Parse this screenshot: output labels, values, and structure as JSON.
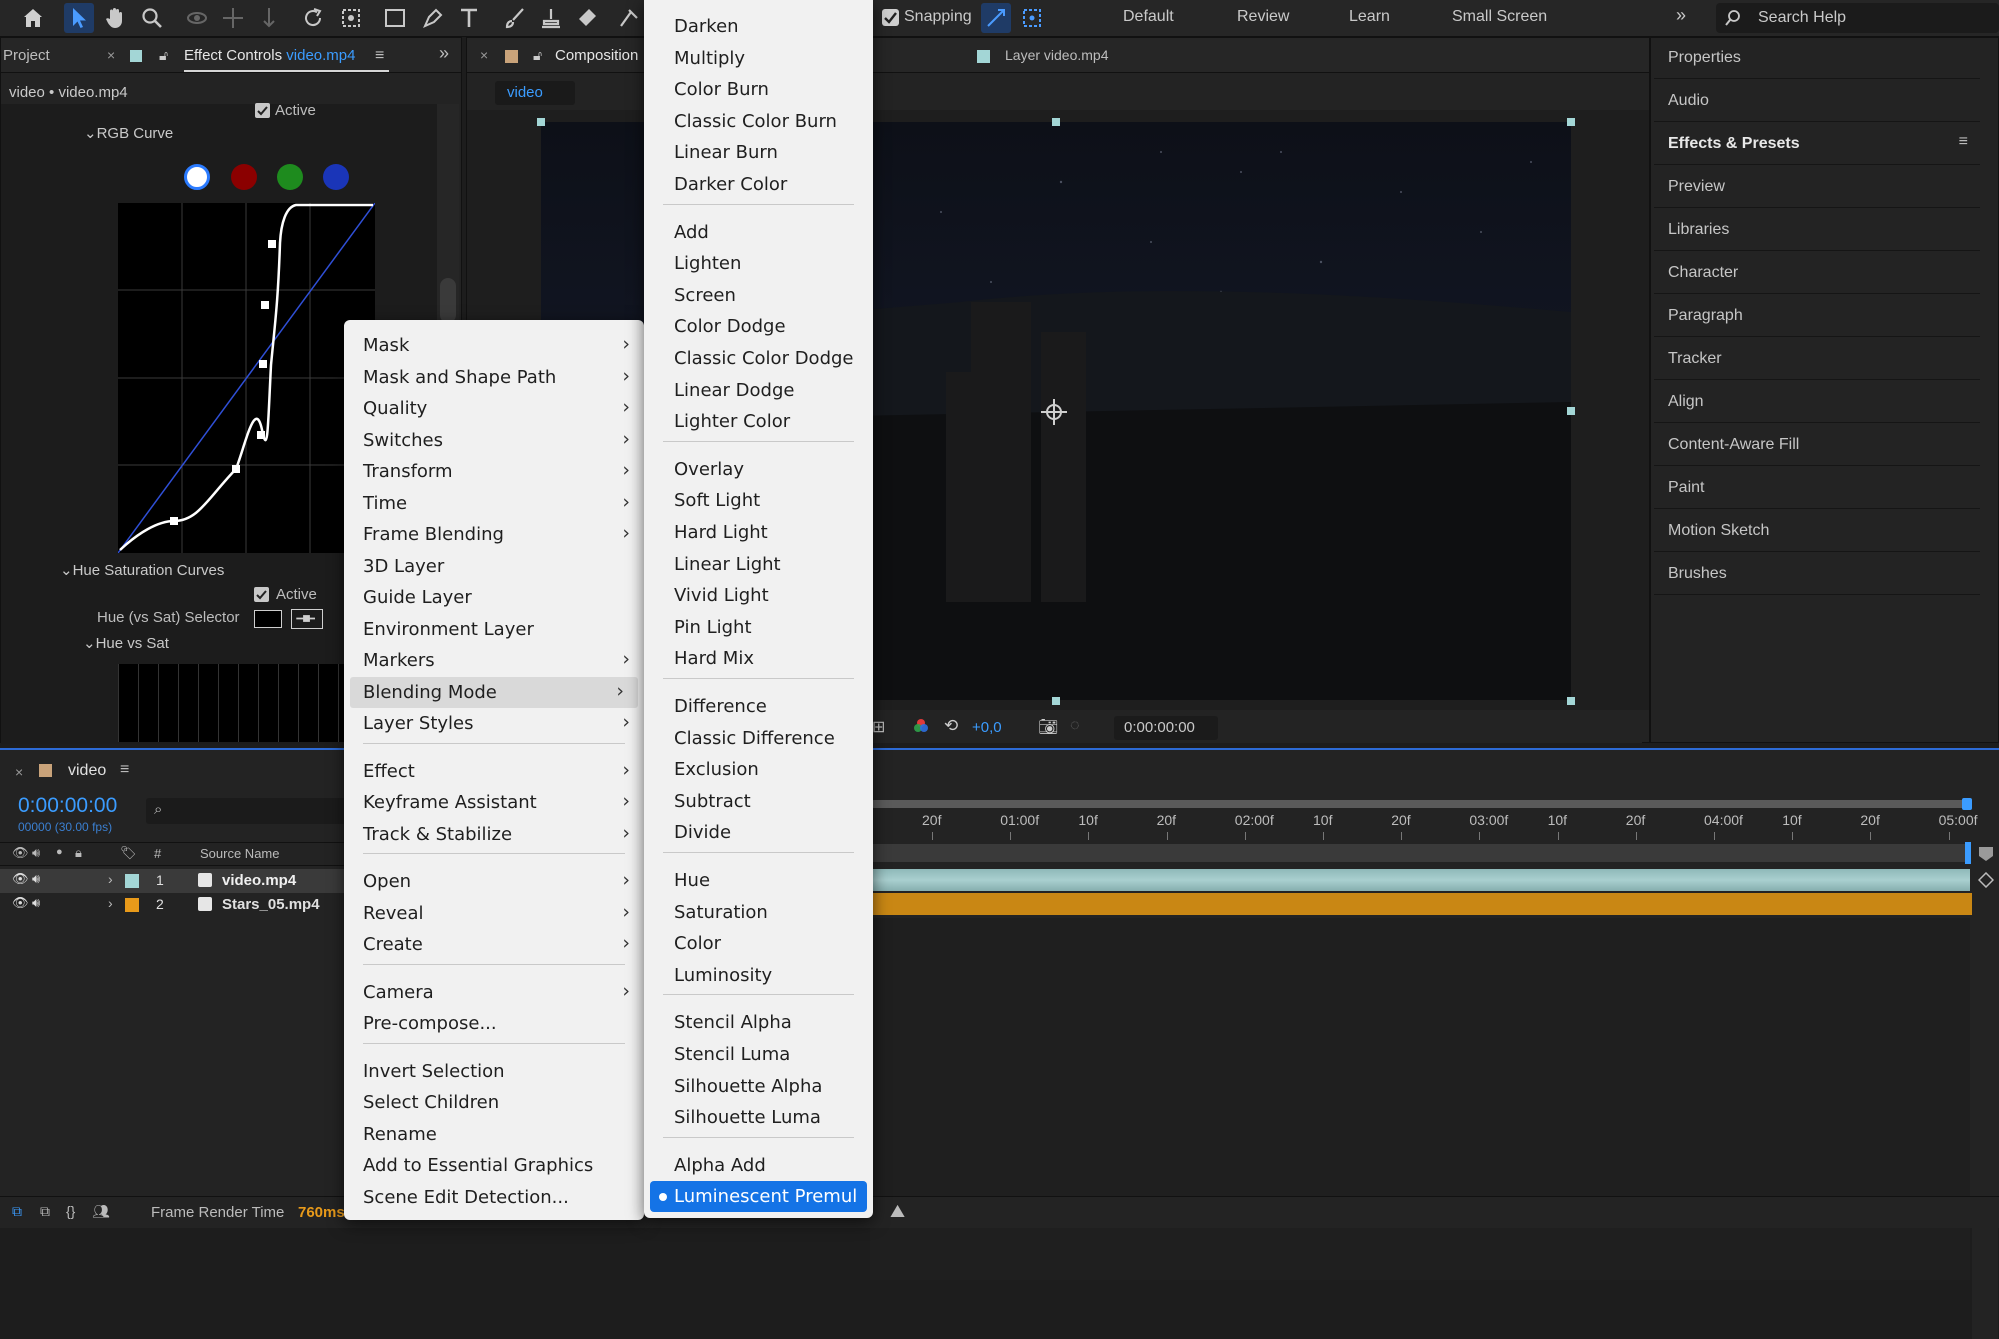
{
  "toolbar": {
    "snapping_label": "Snapping",
    "workspaces": [
      "Default",
      "Review",
      "Learn",
      "Small Screen"
    ],
    "search_placeholder": "Search Help",
    "icons": [
      "home-icon",
      "selection-arrow-icon",
      "hand-icon",
      "zoom-icon",
      "orbit-icon",
      "pan-icon",
      "dolly-icon",
      "rotate-icon",
      "camera-track-icon",
      "rectangle-icon",
      "pen-icon",
      "type-icon",
      "brush-icon",
      "clone-stamp-icon",
      "eraser-icon",
      "roto-brush-icon"
    ]
  },
  "project_tab": {
    "label": "Project"
  },
  "effect_controls": {
    "tab_label": "Effect Controls",
    "tab_file": "video.mp4",
    "breadcrumb": "video • video.mp4",
    "active_label_1": "Active",
    "rgb_curve_label": "RGB Curve",
    "hue_sat_curves_label": "Hue Saturation Curves",
    "active_label_2": "Active",
    "hue_vs_sat_selector_label": "Hue (vs Sat) Selector",
    "hue_vs_sat_label": "Hue vs Sat",
    "channel_colors": [
      "#ffffff",
      "#8b0000",
      "#1e8b1e",
      "#1a35b8"
    ]
  },
  "composition": {
    "tab_label": "Composition",
    "comp_tab": "video",
    "layer_tab": "Layer video.mp4",
    "exposure_value": "+0,0",
    "timecode": "0:00:00:00"
  },
  "right_panel": {
    "items": [
      "Properties",
      "Audio",
      "Effects & Presets",
      "Preview",
      "Libraries",
      "Character",
      "Paragraph",
      "Tracker",
      "Align",
      "Content-Aware Fill",
      "Paint",
      "Motion Sketch",
      "Brushes"
    ]
  },
  "timeline": {
    "comp_name": "video",
    "timecode": "0:00:00:00",
    "frames_fps": "00000 (30.00 fps)",
    "source_name_header": "Source Name",
    "number_header": "#",
    "layers": [
      {
        "num": "1",
        "name": "video.mp4",
        "color": "#a3d6d6"
      },
      {
        "num": "2",
        "name": "Stars_05.mp4",
        "color": "#e89a1a"
      }
    ],
    "ruler_labels": [
      "20f",
      "01:00f",
      "10f",
      "20f",
      "02:00f",
      "10f",
      "20f",
      "03:00f",
      "10f",
      "20f",
      "04:00f",
      "10f",
      "20f",
      "05:00f"
    ],
    "frame_render_label": "Frame Render Time",
    "frame_render_value": "760ms"
  },
  "context_menu": {
    "items": [
      {
        "label": "Mask",
        "sub": true
      },
      {
        "label": "Mask and Shape Path",
        "sub": true
      },
      {
        "label": "Quality",
        "sub": true
      },
      {
        "label": "Switches",
        "sub": true
      },
      {
        "label": "Transform",
        "sub": true
      },
      {
        "label": "Time",
        "sub": true
      },
      {
        "label": "Frame Blending",
        "sub": true
      },
      {
        "label": "3D Layer",
        "sub": false
      },
      {
        "label": "Guide Layer",
        "sub": false
      },
      {
        "label": "Environment Layer",
        "sub": false
      },
      {
        "label": "Markers",
        "sub": true
      },
      {
        "label": "Blending Mode",
        "sub": true
      },
      {
        "label": "Layer Styles",
        "sub": true
      },
      {
        "label": "Effect",
        "sub": true
      },
      {
        "label": "Keyframe Assistant",
        "sub": true
      },
      {
        "label": "Track & Stabilize",
        "sub": true
      },
      {
        "label": "Open",
        "sub": true
      },
      {
        "label": "Reveal",
        "sub": true
      },
      {
        "label": "Create",
        "sub": true
      },
      {
        "label": "Camera",
        "sub": true
      },
      {
        "label": "Pre-compose...",
        "sub": false
      },
      {
        "label": "Invert Selection",
        "sub": false
      },
      {
        "label": "Select Children",
        "sub": false
      },
      {
        "label": "Rename",
        "sub": false
      },
      {
        "label": "Add to Essential Graphics",
        "sub": false
      },
      {
        "label": "Scene Edit Detection...",
        "sub": false
      }
    ],
    "highlighted": "Blending Mode"
  },
  "blend_submenu": {
    "items": [
      "Darken",
      "Multiply",
      "Color Burn",
      "Classic Color Burn",
      "Linear Burn",
      "Darker Color",
      "Add",
      "Lighten",
      "Screen",
      "Color Dodge",
      "Classic Color Dodge",
      "Linear Dodge",
      "Lighter Color",
      "Overlay",
      "Soft Light",
      "Hard Light",
      "Linear Light",
      "Vivid Light",
      "Pin Light",
      "Hard Mix",
      "Difference",
      "Classic Difference",
      "Exclusion",
      "Subtract",
      "Divide",
      "Hue",
      "Saturation",
      "Color",
      "Luminosity",
      "Stencil Alpha",
      "Stencil Luma",
      "Silhouette Alpha",
      "Silhouette Luma",
      "Alpha Add",
      "Luminescent Premul"
    ],
    "selected": "Luminescent Premul"
  }
}
